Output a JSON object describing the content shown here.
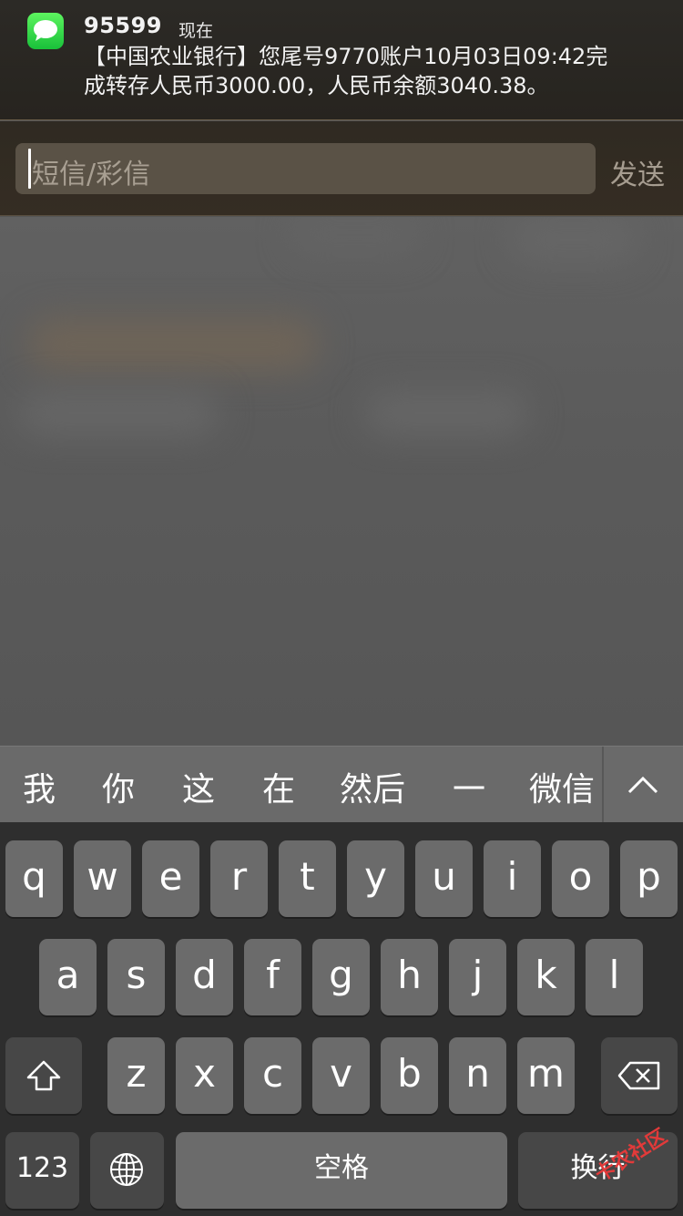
{
  "notification": {
    "app_icon": "messages-icon",
    "sender": "95599",
    "time": "现在",
    "message_line1": "【中国农业银行】您尾号9770账户10月03日09:42完",
    "message_line2": "成转存人民币3000.00，人民币余额3040.38。"
  },
  "reply": {
    "placeholder": "短信/彩信",
    "send_label": "发送"
  },
  "candidates": {
    "items": [
      "我",
      "你",
      "这",
      "在",
      "然后",
      "一",
      "微信"
    ],
    "toggle_icon": "chevron-up-icon"
  },
  "keyboard": {
    "row1": [
      "q",
      "w",
      "e",
      "r",
      "t",
      "y",
      "u",
      "i",
      "o",
      "p"
    ],
    "row2": [
      "a",
      "s",
      "d",
      "f",
      "g",
      "h",
      "j",
      "k",
      "l"
    ],
    "row3": [
      "z",
      "x",
      "c",
      "v",
      "b",
      "n",
      "m"
    ],
    "shift_icon": "shift-icon",
    "delete_icon": "backspace-icon",
    "numbers_label": "123",
    "globe_icon": "globe-icon",
    "space_label": "空格",
    "return_label": "换行"
  },
  "watermark": "卡农社区",
  "colors": {
    "messages_green": "#2fd64a",
    "key_bg": "#6b6b6b",
    "keyboard_bg": "#2e2e2e"
  }
}
